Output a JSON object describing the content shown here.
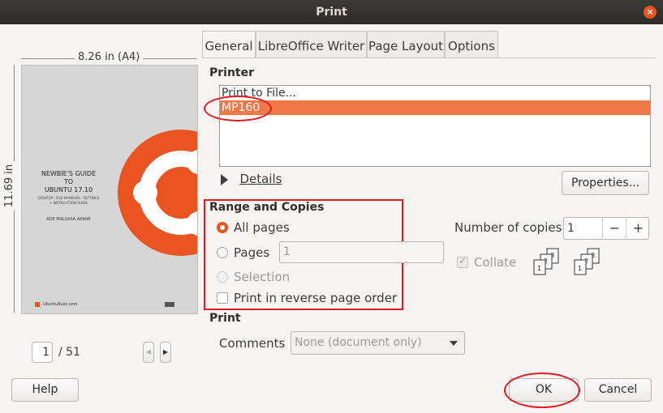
{
  "window": {
    "title": "Print",
    "close_icon": "×"
  },
  "preview": {
    "width_label": "8.26 in (A4)",
    "height_label": "11.69 in",
    "doc_title_1": "NEWBIE'S GUIDE",
    "doc_title_2": "TO",
    "doc_title_3": "UBUNTU 17.10",
    "doc_subtitle_1": "DESKTOP - FILE MANAGER - SETTINGS",
    "doc_subtitle_2": "+ INSTALLATION GUIDE",
    "doc_author": "ADE MALSASA AKBAR",
    "doc_footer": "UbuntuBuzz.com",
    "page_current": "1",
    "page_total": "/ 51"
  },
  "tabs": [
    "General",
    "LibreOffice Writer",
    "Page Layout",
    "Options"
  ],
  "printer": {
    "section_title": "Printer",
    "items": [
      "Print to File...",
      "MP160"
    ],
    "selected_index": 1,
    "details_label": "Details",
    "properties_label": "Properties..."
  },
  "range": {
    "section_title": "Range and Copies",
    "all_pages": "All pages",
    "pages": "Pages",
    "pages_value": "1",
    "selection": "Selection",
    "reverse": "Print in reverse page order"
  },
  "copies": {
    "label": "Number of copies",
    "value": "1",
    "minus": "−",
    "plus": "+",
    "collate": "Collate"
  },
  "print_section": {
    "title": "Print",
    "comments_label": "Comments",
    "comments_value": "None (document only)"
  },
  "buttons": {
    "help": "Help",
    "ok": "OK",
    "cancel": "Cancel"
  },
  "colors": {
    "accent": "#e95420",
    "selection": "#f07746",
    "annotation": "#e01b24"
  }
}
